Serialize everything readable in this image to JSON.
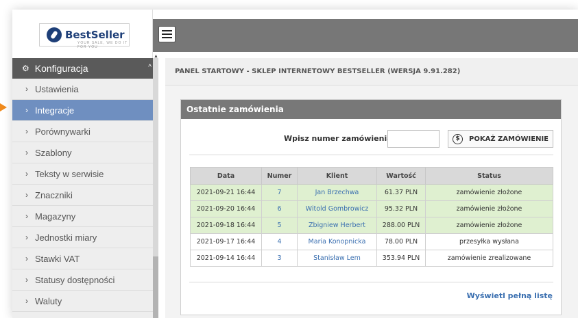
{
  "brand": {
    "name": "BestSeller",
    "tagline": "YOUR SALE, WE DO IT FOR YOU"
  },
  "sidebar": {
    "section_label": "Konfiguracja",
    "items": [
      {
        "label": "Ustawienia"
      },
      {
        "label": "Integracje",
        "active": true
      },
      {
        "label": "Porównywarki"
      },
      {
        "label": "Szablony"
      },
      {
        "label": "Teksty w serwisie"
      },
      {
        "label": "Znaczniki"
      },
      {
        "label": "Magazyny"
      },
      {
        "label": "Jednostki miary"
      },
      {
        "label": "Stawki VAT"
      },
      {
        "label": "Statusy dostępności"
      },
      {
        "label": "Waluty"
      }
    ]
  },
  "page": {
    "title": "PANEL STARTOWY - SKLEP INTERNETOWY BESTSELLER (WERSJA 9.91.282)"
  },
  "orders_panel": {
    "title": "Ostatnie zamówienia",
    "search_label": "Wpisz numer zamówienia:",
    "search_value": "",
    "show_button": "POKAŻ ZAMÓWIENIE",
    "columns": [
      "Data",
      "Numer",
      "Klient",
      "Wartość",
      "Status"
    ],
    "rows": [
      {
        "date": "2021-09-21 16:44",
        "number": "7",
        "client": "Jan Brzechwa",
        "value": "61.37 PLN",
        "status": "zamówienie złożone"
      },
      {
        "date": "2021-09-20 16:44",
        "number": "6",
        "client": "Witold Gombrowicz",
        "value": "95.32 PLN",
        "status": "zamówienie złożone"
      },
      {
        "date": "2021-09-18 16:44",
        "number": "5",
        "client": "Zbigniew Herbert",
        "value": "288.00 PLN",
        "status": "zamówienie złożone"
      },
      {
        "date": "2021-09-17 16:44",
        "number": "4",
        "client": "Maria Konopnicka",
        "value": "78.00 PLN",
        "status": "przesyłka wysłana"
      },
      {
        "date": "2021-09-14 16:44",
        "number": "3",
        "client": "Stanisław Lem",
        "value": "353.94 PLN",
        "status": "zamówienie zrealizowane"
      }
    ],
    "full_list_link": "Wyświetl pełną listę"
  },
  "colors": {
    "active_item": "#6f8fc0",
    "highlight_row": "#dff0d0",
    "indicator": "#f08a1c",
    "link": "#3a6fb0"
  }
}
